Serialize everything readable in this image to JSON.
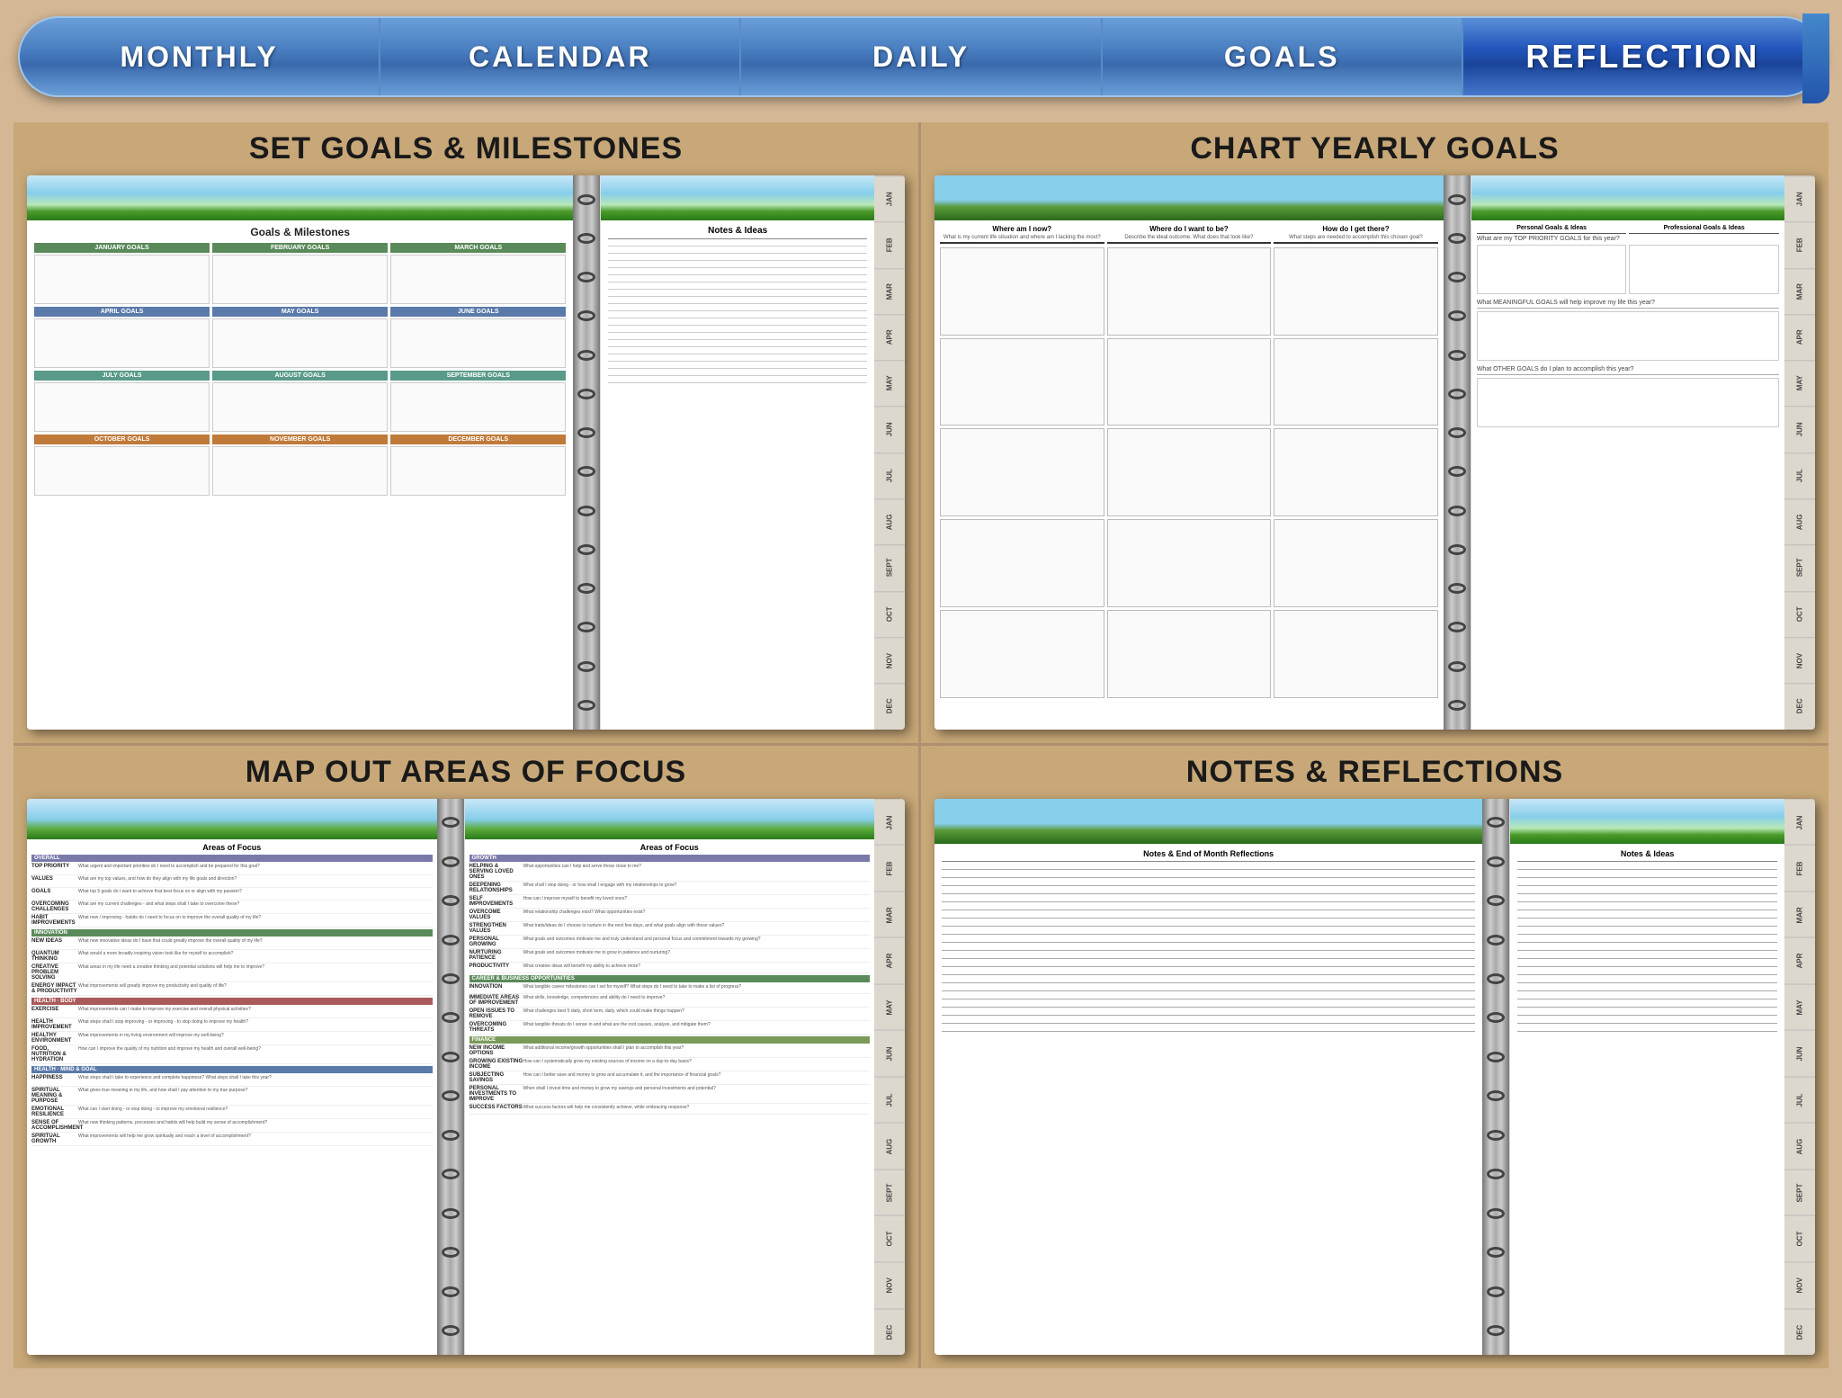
{
  "nav": {
    "items": [
      {
        "label": "MONTHLY",
        "active": false
      },
      {
        "label": "CALENDAR",
        "active": false
      },
      {
        "label": "DAILY",
        "active": false
      },
      {
        "label": "GOALS",
        "active": false
      },
      {
        "label": "REFLECTION",
        "active": true
      }
    ]
  },
  "panels": {
    "topLeft": {
      "title": "SET GOALS & MILESTONES",
      "leftPage": {
        "heading": "Goals & Milestones",
        "sections": [
          {
            "months": [
              "JANUARY GOALS",
              "FEBRUARY GOALS",
              "MARCH GOALS"
            ],
            "colorClass": "green"
          },
          {
            "months": [
              "APRIL GOALS",
              "MAY GOALS",
              "JUNE GOALS"
            ],
            "colorClass": "blue"
          },
          {
            "months": [
              "JULY GOALS",
              "AUGUST GOALS",
              "SEPTEMBER GOALS"
            ],
            "colorClass": "teal"
          },
          {
            "months": [
              "OCTOBER GOALS",
              "NOVEMBER GOALS",
              "DECEMBER GOALS"
            ],
            "colorClass": "orange"
          }
        ]
      },
      "rightPage": {
        "heading": "Notes & Ideas"
      },
      "months": [
        "JAN",
        "FEB",
        "MAR",
        "APR",
        "MAY",
        "JUN",
        "JUL",
        "AUG",
        "SEPT",
        "OCT",
        "NOV",
        "DEC"
      ]
    },
    "topRight": {
      "title": "CHART YEARLY GOALS",
      "leftPage": {
        "columns": [
          "Where am I now?",
          "Where do I want to be?",
          "How do I get there?"
        ],
        "subheadings": [
          "What is my current life situation and where am I lacking the most?",
          "Describe the ideal outcome. What does that look like?",
          "What steps are needed to accomplish this chosen goal?"
        ]
      },
      "rightPage": {
        "sections": [
          {
            "colHeaders": [
              "Personal Goals & Ideas",
              "Professional Goals & Ideas"
            ],
            "question": "What are my TOP PRIORITY GOALS for this year?"
          },
          {
            "question": "What MEANINGFUL GOALS will help improve my life this year?"
          },
          {
            "question": "What OTHER GOALS do I plan to accomplish this year?"
          }
        ]
      },
      "months": [
        "JAN",
        "FEB",
        "MAR",
        "APR",
        "MAY",
        "JUN",
        "JUL",
        "AUG",
        "SEPT",
        "OCT",
        "NOV",
        "DEC"
      ]
    },
    "bottomLeft": {
      "title": "MAP OUT AREAS OF FOCUS",
      "leftPage": {
        "heading": "Areas of Focus",
        "sections": [
          {
            "name": "OVERALL",
            "colorClass": "overall",
            "items": [
              {
                "label": "TOP PRIORITY",
                "content": "What urgent and important priorities do I need to accomplish and be prepared for this goal?"
              },
              {
                "label": "VALUES",
                "content": "What are my top values, and how do they align with my life goals and direction?"
              },
              {
                "label": "GOALS",
                "content": "What top 5 goals do I want to achieve that best focus on or align with my passion?"
              },
              {
                "label": "OVERCOMING CHALLENGES",
                "content": "What are my current challenges - and what steps shall I take to overcome these?"
              },
              {
                "label": "HABIT IMPROVEMENTS",
                "content": "What new / improving - habits do I need to focus on to improve the overall quality of my life?"
              }
            ]
          },
          {
            "name": "INNOVATION",
            "colorClass": "innovation",
            "items": [
              {
                "label": "NEW IDEAS",
                "content": "What new innovative ideas do I have that could greatly improve the overall quality of my life?"
              },
              {
                "label": "QUANTUM THINKING",
                "content": "What would a more person the broadly inspiring vision look like for myself to accomplish?"
              },
              {
                "label": "CREATIVE PROBLEM SOLVING",
                "content": "What areas in my life need a creative thinking and potential solutions will help me to improve?"
              },
              {
                "label": "ENERGY IMPACT & PRODUCTIVITY",
                "content": "What improvements will greatly improve my productivity and quality of life?"
              }
            ]
          }
        ]
      },
      "rightPage": {
        "heading": "Areas of Focus",
        "sections": [
          {
            "name": "GROWTH",
            "colorClass": "overall",
            "items": [
              {
                "label": "HELPING & SERVING LOVED ONES",
                "content": "What opportunities can I help and serve those close to me?"
              },
              {
                "label": "DEEPENING RELATIONSHIPS",
                "content": "What shall I stop doing - or how shall I engage with my relationships to grow?"
              },
              {
                "label": "SELF IMPROVEMENTS",
                "content": "How can I improve myself to benefit my loved ones?"
              },
              {
                "label": "OVERCOME VALUES",
                "content": "What relationship challenges exist? What opportunities exist?"
              },
              {
                "label": "STRENGTHEN VALUES",
                "content": "What traits/ideas do I choose to nurture in the next few days, and what goals align with those values?"
              },
              {
                "label": "PERSONAL GROWING",
                "content": "What goals and outcomes motivate me and truly understand and personal focus and commitment towards my growing?"
              },
              {
                "label": "NURTURING PATIENCE",
                "content": "What goals and outcomes motivate me..."
              },
              {
                "label": "PRODUCTIVITY",
                "content": "What creative ideas will benefit my ability to achieve more?"
              }
            ]
          },
          {
            "name": "CAREER & BUSINESS OPPORTUNITIES",
            "items": [
              {
                "label": "INNOVATION",
                "content": "What tangible career milestones can I set for myself? What steps do I need to take to make a list of progress?"
              },
              {
                "label": "IMMEDIATE AREAS OF IMPROVEMENT",
                "content": "What skills, knowledge, competencies and ability do I need to improve?"
              },
              {
                "label": "OPEN ISSUES TO REMOVE",
                "content": "What challenges best 5 daily, short term, daily, which could make things happen?"
              },
              {
                "label": "OVERCOMING THREATS",
                "content": "What tangible threats do I sense in and what are the root causes, analyze, and mitigate them?"
              },
              {
                "label": "NEW INCOME OPTIONS",
                "content": "What additional income/growth opportunities shall I plan to accomplish this year?"
              },
              {
                "label": "GROWING EXISTING INCOME",
                "content": "How can I systematically grow my existing sources of income on a day-to-day basis?"
              },
              {
                "label": "SUBJECTING SAVINGS",
                "content": "How can I better save and money to grow and accumulate it, and the importance of financial goals?"
              },
              {
                "label": "PERSONAL INVESTMENTS TO IMPROVE",
                "content": "When shall I invest time and money to grow my savings and personal investments and potential?"
              },
              {
                "label": "SUCCESS FACTORS",
                "content": "What success factors will help me consistently achieve, while embracing response?"
              }
            ]
          }
        ]
      },
      "months": [
        "JAN",
        "FEB",
        "MAR",
        "APR",
        "MAY",
        "JUN",
        "JUL",
        "AUG",
        "SEPT",
        "OCT",
        "NOV",
        "DEC"
      ]
    },
    "bottomRight": {
      "title": "NOTES & REFLECTIONS",
      "leftPage": {
        "heading": "Notes & End of Month Reflections"
      },
      "rightPage": {
        "heading": "Notes & Ideas"
      },
      "months": [
        "JAN",
        "FEB",
        "MAR",
        "APR",
        "MAY",
        "JUN",
        "JUL",
        "AUG",
        "SEPT",
        "OCT",
        "NOV",
        "DEC"
      ]
    }
  }
}
